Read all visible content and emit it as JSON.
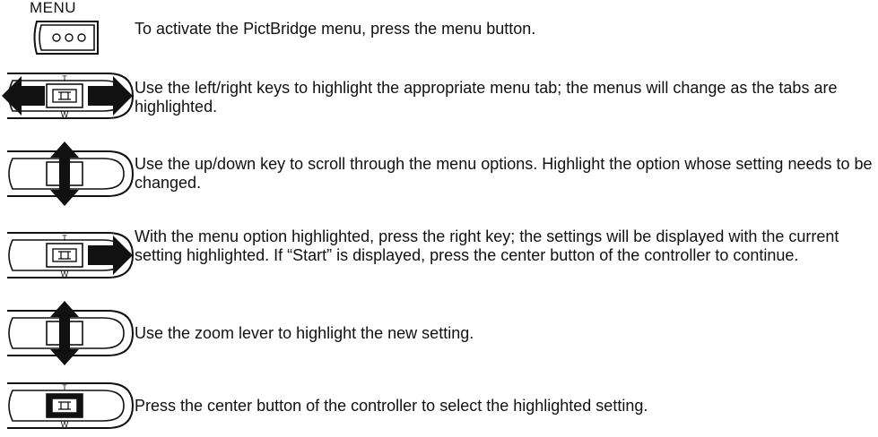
{
  "menu_button": {
    "label": "MENU",
    "icon": "menu-button-icon"
  },
  "steps": [
    {
      "text": "To activate the PictBridge menu, press the menu button.",
      "icon": "menu-button-icon"
    },
    {
      "text": "Use the left/right keys to highlight the appropriate menu tab; the menus will change as the tabs are highlighted.",
      "icon": "controller-left-right-icon"
    },
    {
      "text": "Use the up/down key to scroll through the menu options. Highlight the option whose setting needs to be changed.",
      "icon": "controller-up-down-icon"
    },
    {
      "text": "With the menu option highlighted, press the right key; the settings will be displayed with the current setting highlighted. If “Start” is displayed, press the center button of the controller to continue.",
      "icon": "controller-right-icon"
    },
    {
      "text": "Use the zoom lever to highlight the new setting.",
      "icon": "controller-up-down-icon"
    },
    {
      "text": "Press the center button of the controller to select the highlighted setting.",
      "icon": "controller-center-icon"
    }
  ],
  "controller_labels": {
    "top": "T",
    "bottom": "W"
  },
  "colors": {
    "ink": "#111111",
    "background": "#ffffff"
  }
}
